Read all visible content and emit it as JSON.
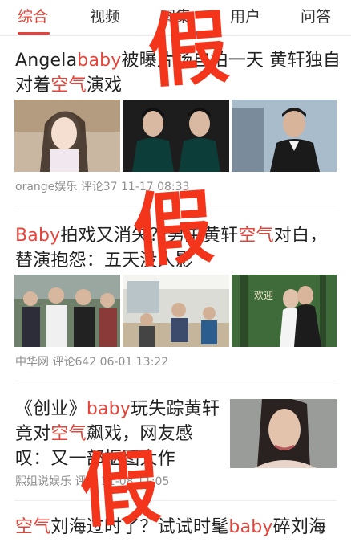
{
  "tabs": [
    "综合",
    "视频",
    "图集",
    "用户",
    "问答"
  ],
  "articles": [
    {
      "title_line1": [
        {
          "t": "Angela",
          "hl": false
        },
        {
          "t": "baby",
          "hl": true
        },
        {
          "t": "被曝片场自拍一天 黄轩独自",
          "hl": false
        }
      ],
      "title_line2": [
        {
          "t": "对着",
          "hl": false
        },
        {
          "t": "空气",
          "hl": true
        },
        {
          "t": "演戏",
          "hl": false
        }
      ],
      "meta": "orange娱乐  评论37  11-17 08:33"
    },
    {
      "title_line1": [
        {
          "t": "Baby",
          "hl": true
        },
        {
          "t": "拍戏又消失？男主黄轩",
          "hl": false
        },
        {
          "t": "空气",
          "hl": true
        },
        {
          "t": "对白，",
          "hl": false
        }
      ],
      "title_line2": [
        {
          "t": "替演抱怨：五天没人影",
          "hl": false
        }
      ],
      "meta": "中华网  评论642  06-01 13:22"
    },
    {
      "title_line1": [
        {
          "t": "《创业》",
          "hl": false
        },
        {
          "t": "baby",
          "hl": true
        },
        {
          "t": "玩失踪黄轩",
          "hl": false
        }
      ],
      "title_line2": [
        {
          "t": "竟对",
          "hl": false
        },
        {
          "t": "空气",
          "hl": true
        },
        {
          "t": "飙戏，网友感",
          "hl": false
        }
      ],
      "title_line3": [
        {
          "t": "叹：又一部抠图大作",
          "hl": false
        }
      ],
      "meta": "熙姐说娱乐  评论  11-08 11:05"
    },
    {
      "title_line1": [
        {
          "t": "空气",
          "hl": true
        },
        {
          "t": "刘海过时了？试试时髦",
          "hl": false
        },
        {
          "t": "baby",
          "hl": true
        },
        {
          "t": "碎刘海",
          "hl": false
        }
      ]
    }
  ],
  "watermark": "假",
  "colors": {
    "accent": "#e4443a",
    "watermark": "#f2351b",
    "meta": "#8f8f8f"
  }
}
